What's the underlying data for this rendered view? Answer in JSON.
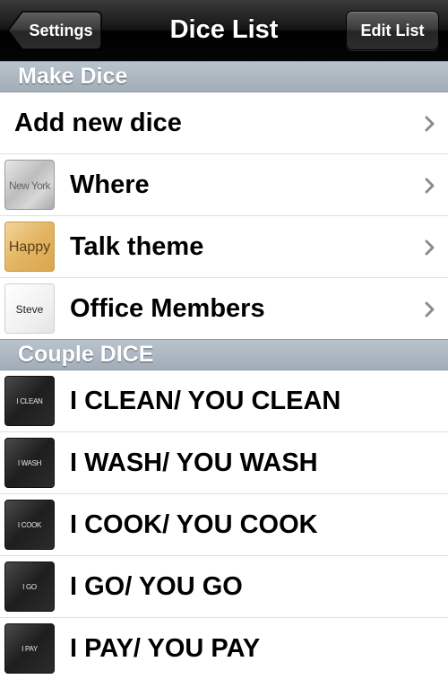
{
  "navbar": {
    "title": "Dice List",
    "back_label": "Settings",
    "edit_label": "Edit List"
  },
  "sections": {
    "make": {
      "header": "Make Dice",
      "add_new": "Add new dice",
      "items": [
        {
          "label": "Where",
          "thumb": "New York"
        },
        {
          "label": "Talk theme",
          "thumb": "Happy"
        },
        {
          "label": "Office Members",
          "thumb": "Steve"
        }
      ]
    },
    "couple": {
      "header": "Couple DICE",
      "items": [
        {
          "label": "I CLEAN/ YOU CLEAN",
          "thumb": "I CLEAN"
        },
        {
          "label": "I WASH/ YOU WASH",
          "thumb": "I WASH"
        },
        {
          "label": "I COOK/ YOU COOK",
          "thumb": "I COOK"
        },
        {
          "label": "I GO/ YOU GO",
          "thumb": "I GO"
        },
        {
          "label": "I PAY/ YOU PAY",
          "thumb": "I PAY"
        }
      ]
    }
  },
  "icons": {
    "disclosure": "chevron-right-icon"
  },
  "colors": {
    "navbar": "#000000",
    "section_header": "#a8b3be",
    "chevron": "#8c8c8c"
  }
}
